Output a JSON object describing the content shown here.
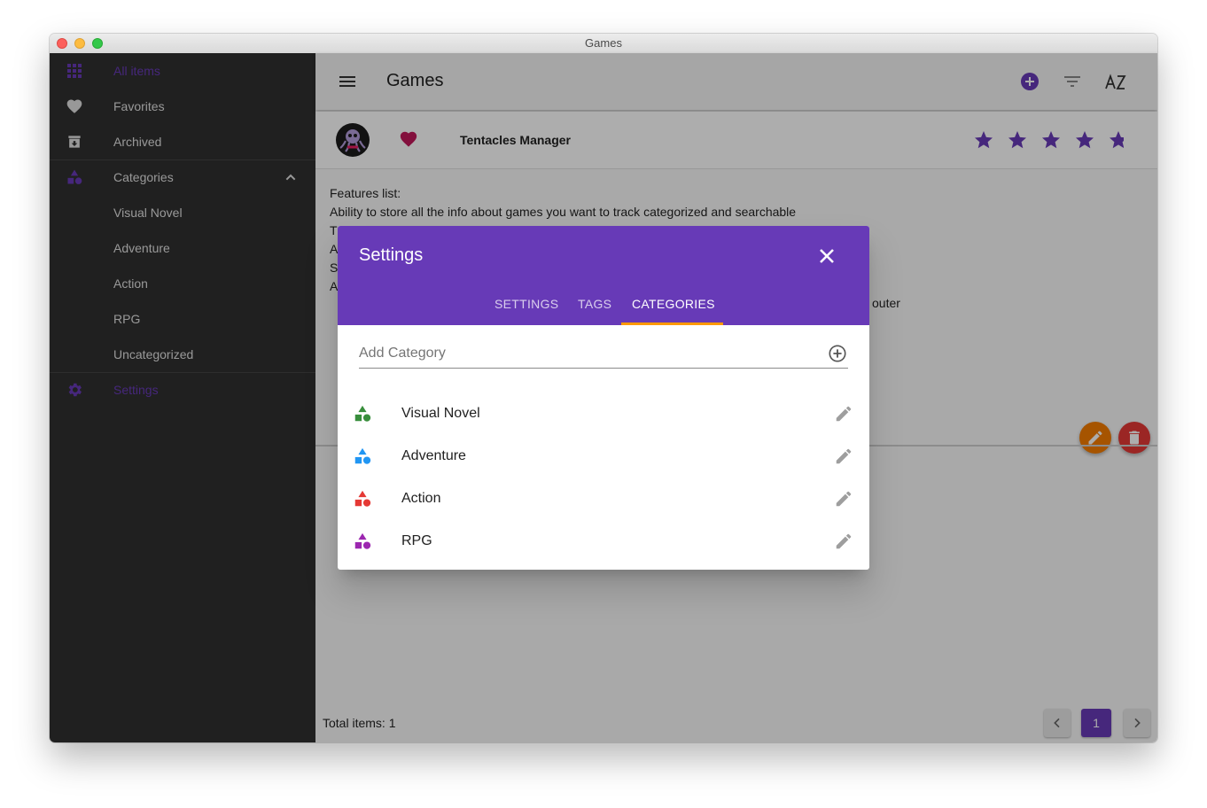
{
  "window": {
    "title": "Games"
  },
  "sidebar": {
    "items": [
      {
        "label": "All items",
        "icon": "grid-icon",
        "active": true
      },
      {
        "label": "Favorites",
        "icon": "heart-icon"
      },
      {
        "label": "Archived",
        "icon": "archive-icon"
      },
      {
        "label": "Categories",
        "icon": "shapes-icon",
        "expanded": true
      },
      {
        "label": "Visual Novel"
      },
      {
        "label": "Adventure"
      },
      {
        "label": "Action"
      },
      {
        "label": "RPG"
      },
      {
        "label": "Uncategorized"
      },
      {
        "label": "Settings",
        "icon": "gear-icon",
        "active": true
      }
    ]
  },
  "appbar": {
    "title": "Games",
    "icons": [
      "menu-icon",
      "add-circle-icon",
      "filter-icon",
      "sort-az-icon"
    ]
  },
  "game": {
    "title": "Tentacles Manager",
    "favorite": true,
    "rating": 5,
    "description": [
      "Features list:",
      "Ability to store all the info about games you want to track categorized and searchable",
      "T",
      "A",
      "S",
      "A",
      "outer"
    ]
  },
  "footer": {
    "total": "Total items: 1",
    "page": "1"
  },
  "dialog": {
    "title": "Settings",
    "tabs": [
      "SETTINGS",
      "TAGS",
      "CATEGORIES"
    ],
    "active_tab": "CATEGORIES",
    "add_placeholder": "Add Category",
    "categories": [
      {
        "label": "Visual Novel",
        "color": "#388e3c"
      },
      {
        "label": "Adventure",
        "color": "#2196f3"
      },
      {
        "label": "Action",
        "color": "#e53935"
      },
      {
        "label": "RPG",
        "color": "#9c27b0"
      }
    ]
  },
  "colors": {
    "accent": "#673ab7",
    "favorite": "#c2185b",
    "tab_indicator": "#ff9800",
    "edit_fab": "#f57c00",
    "delete_fab": "#e53935"
  }
}
